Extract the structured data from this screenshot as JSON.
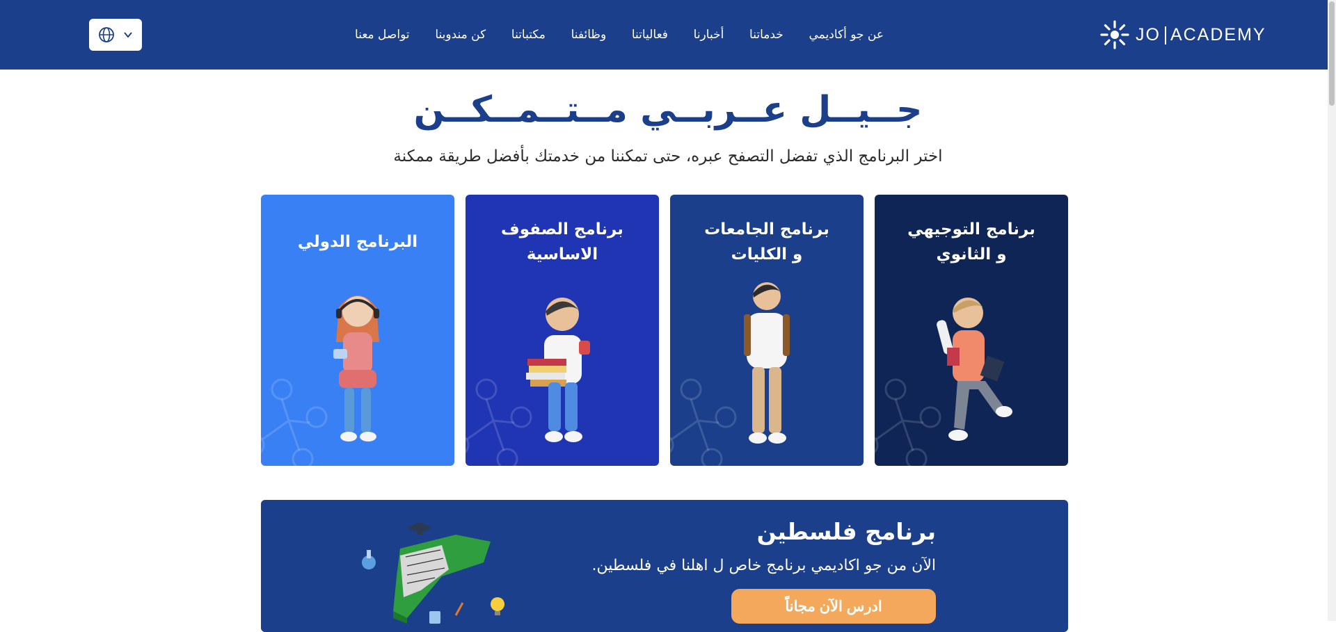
{
  "header": {
    "logo_text_left": "JO",
    "logo_text_right": "ACADEMY",
    "nav": [
      "عن جو أكاديمي",
      "خدماتنا",
      "أخبارنا",
      "فعالياتنا",
      "وظائفنا",
      "مكتباتنا",
      "كن مندوبنا",
      "تواصل معنا"
    ],
    "language_icon": "globe-icon",
    "dropdown_icon": "chevron-down-icon"
  },
  "hero": {
    "title": "جــيــل عــربــي مــتــمــكــن",
    "subtitle": "اختر البرنامج الذي تفضل التصفح عبره، حتى تمكننا من خدمتك بأفضل طريقة ممكنة"
  },
  "cards": [
    {
      "title": "برنامج التوجيهي\nو الثانوي",
      "color": "#0e2556"
    },
    {
      "title": "برنامج الجامعات\nو الكليات",
      "color": "#1b3f8b"
    },
    {
      "title": "برنامج الصفوف\nالاساسية",
      "color": "#1f35b4"
    },
    {
      "title": "البرنامج الدولي",
      "color": "#3a80f5"
    }
  ],
  "palestine": {
    "title": "برنامج فلسطين",
    "text": "الآن من جو اكاديمي برنامج خاص ل اهلنا في فلسطين.",
    "button": "ادرس الآن مجاناً"
  },
  "colors": {
    "header_bg": "#1b3f8b",
    "title": "#1b3f8b",
    "button": "#f3a85b"
  }
}
